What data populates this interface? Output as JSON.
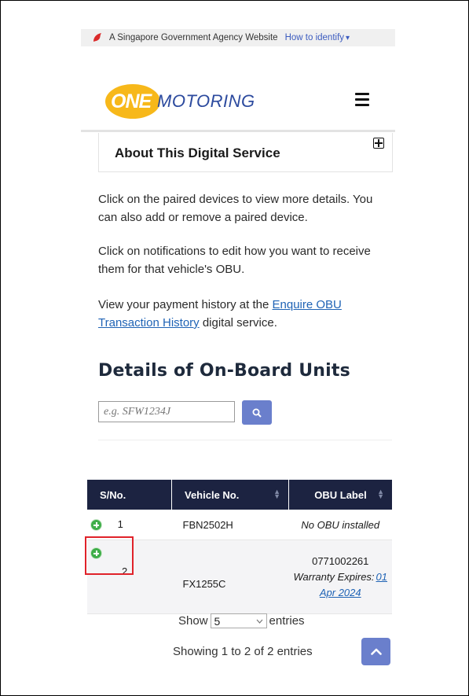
{
  "gov_banner": {
    "text": "A Singapore Government Agency Website",
    "link": "How to identify",
    "chevron": "▾"
  },
  "header": {
    "logo_one": "ONE",
    "logo_motoring": "MOTORING",
    "menu_icon": "hamburger-icon"
  },
  "about": {
    "title": "About This Digital Service",
    "expand_icon": "plus-square-icon"
  },
  "intro": {
    "p1": "Click on the paired devices to view more details. You can also add or remove a paired device.",
    "p2": "Click on notifications to edit how you want to receive them for that vehicle's OBU.",
    "p3_prefix": "View your payment history at the ",
    "p3_link": "Enquire OBU Transaction History",
    "p3_suffix": " digital service."
  },
  "section": {
    "title": "Details of On-Board Units"
  },
  "search": {
    "placeholder": "e.g. SFW1234J",
    "icon": "search-icon"
  },
  "table": {
    "headers": [
      "S/No.",
      "Vehicle No.",
      "OBU Label"
    ],
    "rows": [
      {
        "sno": "1",
        "vehicle": "FBN2502H",
        "obu": "No OBU installed"
      },
      {
        "sno": "2",
        "vehicle": "FX1255C",
        "obu": "0771002261",
        "warranty_label": "Warranty Expires:",
        "warranty_date_1": "01",
        "warranty_date_2": "Apr 2024"
      }
    ]
  },
  "pagination": {
    "show": "Show",
    "length": "5",
    "entries": "entries",
    "summary": "Showing 1 to 2 of 2 entries",
    "top_icon": "chevron-up-icon"
  },
  "colors": {
    "header_bg": "#1c2341",
    "button_bg": "#6a7fcc",
    "link": "#1f63b5",
    "logo_yellow": "#f7b81a",
    "logo_blue": "#2c4a9e",
    "highlight": "#e0222a",
    "add_icon": "#3fae49"
  }
}
